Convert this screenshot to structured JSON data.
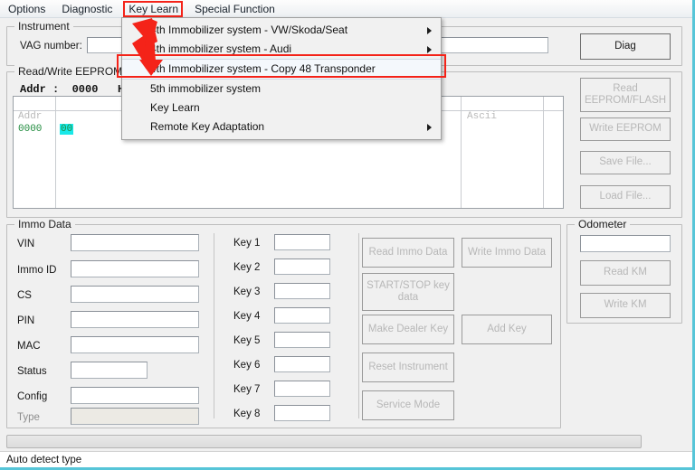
{
  "window": {
    "accent_border_color": "#56c5d8",
    "highlight_box_color": "#f42319"
  },
  "menubar": {
    "items": [
      {
        "label": "Options"
      },
      {
        "label": "Diagnostic"
      },
      {
        "label": "Key Learn"
      },
      {
        "label": "Special Function"
      }
    ]
  },
  "dropdown": {
    "open_for": "Key Learn",
    "items": [
      {
        "label": "4th Immobilizer system - VW/Skoda/Seat",
        "submenu": true,
        "selected": false
      },
      {
        "label": "4th immobilizer system - Audi",
        "submenu": true,
        "selected": false
      },
      {
        "label": "4th Immobilizer system - Copy 48 Transponder",
        "submenu": false,
        "selected": true
      },
      {
        "label": "5th immobilizer system",
        "submenu": false,
        "selected": false
      },
      {
        "label": "Key Learn",
        "submenu": false,
        "selected": false
      },
      {
        "label": "Remote Key Adaptation",
        "submenu": true,
        "selected": false
      }
    ]
  },
  "instrument": {
    "legend": "Instrument",
    "vag_label": "VAG number:",
    "vag_value": "",
    "diag_button": "Diag"
  },
  "eeprom": {
    "legend": "Read/Write EEPROM",
    "addr_header": "Addr :  0000   Hex:",
    "col_addr_header": "Addr",
    "col_ascii_header": "Ascii",
    "rows": [
      {
        "addr": "0000",
        "hex": "00",
        "ascii": ""
      }
    ],
    "buttons": [
      {
        "label": "Read\nEEPROM/FLASH",
        "enabled": false
      },
      {
        "label": "Write EEPROM",
        "enabled": false
      },
      {
        "label": "Save File...",
        "enabled": false
      },
      {
        "label": "Load File...",
        "enabled": false
      }
    ]
  },
  "immo_data": {
    "legend": "Immo Data",
    "fields": [
      {
        "label": "VIN",
        "value": "",
        "enabled": true
      },
      {
        "label": "Immo ID",
        "value": "",
        "enabled": true
      },
      {
        "label": "CS",
        "value": "",
        "enabled": true
      },
      {
        "label": "PIN",
        "value": "",
        "enabled": true
      },
      {
        "label": "MAC",
        "value": "",
        "enabled": true
      },
      {
        "label": "Status",
        "value": "",
        "enabled": true
      },
      {
        "label": "Config",
        "value": "",
        "enabled": true
      },
      {
        "label": "Type",
        "value": "",
        "enabled": false
      }
    ],
    "keys": [
      {
        "label": "Key 1",
        "value": ""
      },
      {
        "label": "Key 2",
        "value": ""
      },
      {
        "label": "Key 3",
        "value": ""
      },
      {
        "label": "Key 4",
        "value": ""
      },
      {
        "label": "Key 5",
        "value": ""
      },
      {
        "label": "Key 6",
        "value": ""
      },
      {
        "label": "Key 7",
        "value": ""
      },
      {
        "label": "Key 8",
        "value": ""
      }
    ],
    "buttons_left": [
      {
        "label": "Read Immo Data",
        "enabled": false
      },
      {
        "label": "START/STOP key data",
        "enabled": false
      },
      {
        "label": "Make Dealer Key",
        "enabled": false
      },
      {
        "label": "Reset Instrument",
        "enabled": false
      },
      {
        "label": "Service Mode",
        "enabled": false
      }
    ],
    "buttons_right": [
      {
        "label": "Write Immo Data",
        "enabled": false
      },
      {
        "label": "Add Key",
        "enabled": false
      }
    ]
  },
  "odometer": {
    "legend": "Odometer",
    "value": "",
    "buttons": [
      {
        "label": "Read KM",
        "enabled": false
      },
      {
        "label": "Write KM",
        "enabled": false
      }
    ]
  },
  "progress": {
    "percent": 0
  },
  "status": {
    "text": "Auto detect type"
  }
}
